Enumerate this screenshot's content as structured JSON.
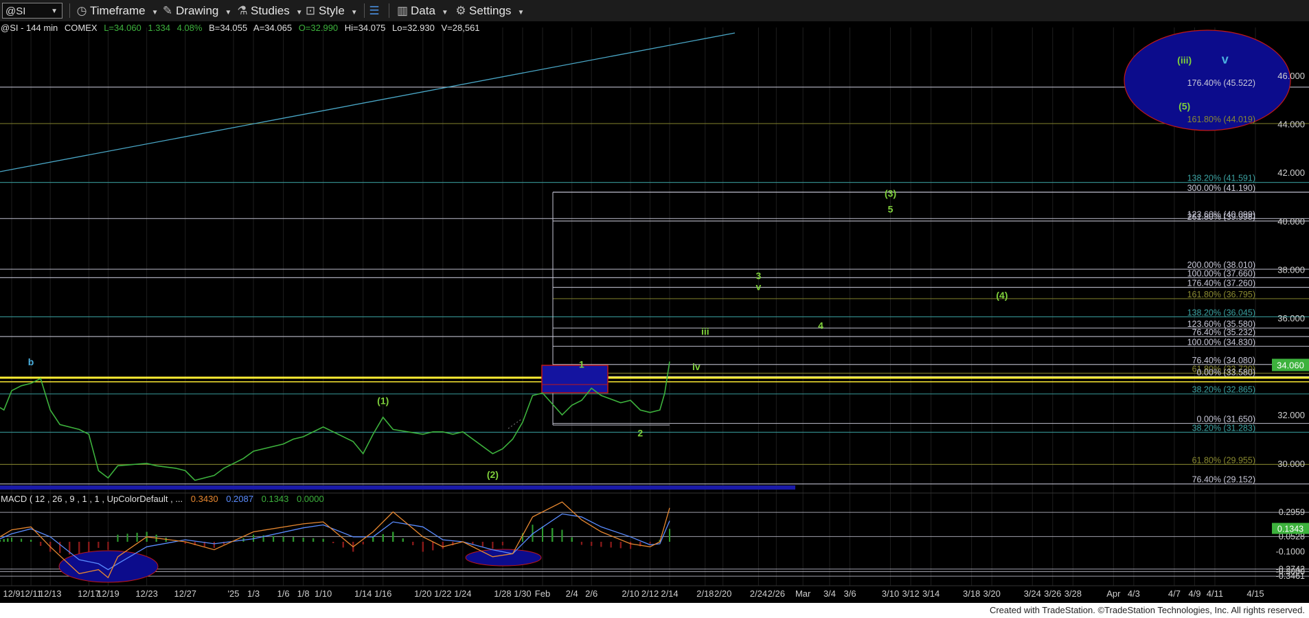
{
  "toolbar": {
    "symbol": "@SI",
    "timeframe": "Timeframe",
    "drawing": "Drawing",
    "studies": "Studies",
    "style": "Style",
    "data": "Data",
    "settings": "Settings"
  },
  "header": {
    "ticker": "@SI - 144 min",
    "exchange": "COMEX",
    "last": "L=34.060",
    "change": "1.334",
    "change_pct": "4.08%",
    "bid": "B=34.055",
    "ask": "A=34.065",
    "open": "O=32.990",
    "high": "Hi=34.075",
    "low": "Lo=32.930",
    "volume": "V=28,561"
  },
  "macd_header": {
    "label": "MACD ( 12 , 26 , 9 , 1 , 1 , UpColorDefault , ...",
    "v1": "0.3430",
    "v2": "0.2087",
    "v3": "0.1343",
    "v4": "0.0000"
  },
  "footer": "Created with TradeStation. ©TradeStation Technologies, Inc. All rights reserved.",
  "colors": {
    "price": "#3db23d",
    "yellow": "#ffee33",
    "fib_white": "#c8c8d8",
    "fib_teal": "#3aa0a0",
    "fib_olive": "#8a8a30",
    "trend": "#4aa8c8",
    "box_blue": "#1414a0",
    "box_red": "#c01818",
    "macd_hist_pos": "#2e9a2e",
    "macd_hist_neg": "#8a1a1a",
    "macd_orange": "#e88830",
    "macd_blue": "#5a8cff",
    "last_price_bg": "#3db23d"
  },
  "chart_data": {
    "type": "line",
    "symbol": "@SI",
    "interval": "144 min",
    "price_axis": {
      "ylim": [
        28.6,
        47.6
      ],
      "ticks": [
        "46.000",
        "44.000",
        "42.000",
        "40.000",
        "38.000",
        "36.000",
        "34.000",
        "32.000",
        "30.000"
      ],
      "tick_values": [
        46,
        44,
        42,
        40,
        38,
        36,
        34,
        32,
        30
      ]
    },
    "last_price": {
      "value": 34.06,
      "label": "34.060"
    },
    "x_axis": {
      "date_range": [
        "2024-12-06",
        "2025-04-17"
      ],
      "ticks": [
        {
          "date": "2024-12-09",
          "label": "12/9"
        },
        {
          "date": "2024-12-11",
          "label": "12/11"
        },
        {
          "date": "2024-12-13",
          "label": "12/13"
        },
        {
          "date": "2024-12-17",
          "label": "12/17"
        },
        {
          "date": "2024-12-19",
          "label": "12/19"
        },
        {
          "date": "2024-12-23",
          "label": "12/23"
        },
        {
          "date": "2024-12-27",
          "label": "12/27"
        },
        {
          "date": "2025-01-01",
          "label": "'25"
        },
        {
          "date": "2025-01-03",
          "label": "1/3"
        },
        {
          "date": "2025-01-06",
          "label": "1/6"
        },
        {
          "date": "2025-01-08",
          "label": "1/8"
        },
        {
          "date": "2025-01-10",
          "label": "1/10"
        },
        {
          "date": "2025-01-14",
          "label": "1/14"
        },
        {
          "date": "2025-01-16",
          "label": "1/16"
        },
        {
          "date": "2025-01-20",
          "label": "1/20"
        },
        {
          "date": "2025-01-22",
          "label": "1/22"
        },
        {
          "date": "2025-01-24",
          "label": "1/24"
        },
        {
          "date": "2025-01-28",
          "label": "1/28"
        },
        {
          "date": "2025-01-30",
          "label": "1/30"
        },
        {
          "date": "2025-02-01",
          "label": "Feb"
        },
        {
          "date": "2025-02-04",
          "label": "2/4"
        },
        {
          "date": "2025-02-06",
          "label": "2/6"
        },
        {
          "date": "2025-02-10",
          "label": "2/10"
        },
        {
          "date": "2025-02-12",
          "label": "2/12"
        },
        {
          "date": "2025-02-14",
          "label": "2/14"
        },
        {
          "date": "2025-02-18",
          "label": "2/18"
        },
        {
          "date": "2025-02-20",
          "label": "2/20"
        },
        {
          "date": "2025-02-24",
          "label": "2/24"
        },
        {
          "date": "2025-02-26",
          "label": "2/26"
        },
        {
          "date": "2025-03-01",
          "label": "Mar"
        },
        {
          "date": "2025-03-04",
          "label": "3/4"
        },
        {
          "date": "2025-03-06",
          "label": "3/6"
        },
        {
          "date": "2025-03-10",
          "label": "3/10"
        },
        {
          "date": "2025-03-12",
          "label": "3/12"
        },
        {
          "date": "2025-03-14",
          "label": "3/14"
        },
        {
          "date": "2025-03-18",
          "label": "3/18"
        },
        {
          "date": "2025-03-20",
          "label": "3/20"
        },
        {
          "date": "2025-03-24",
          "label": "3/24"
        },
        {
          "date": "2025-03-26",
          "label": "3/26"
        },
        {
          "date": "2025-03-28",
          "label": "3/28"
        },
        {
          "date": "2025-04-01",
          "label": "Apr"
        },
        {
          "date": "2025-04-03",
          "label": "4/3"
        },
        {
          "date": "2025-04-07",
          "label": "4/7"
        },
        {
          "date": "2025-04-09",
          "label": "4/9"
        },
        {
          "date": "2025-04-11",
          "label": "4/11"
        },
        {
          "date": "2025-04-15",
          "label": "4/15"
        }
      ]
    },
    "price_series": [
      [
        "2024-12-06",
        32.3
      ],
      [
        "2024-12-07",
        32.2
      ],
      [
        "2024-12-09",
        33.0
      ],
      [
        "2024-12-10",
        33.2
      ],
      [
        "2024-12-11",
        33.3
      ],
      [
        "2024-12-12",
        33.5
      ],
      [
        "2024-12-13",
        32.2
      ],
      [
        "2024-12-14",
        31.6
      ],
      [
        "2024-12-16",
        31.4
      ],
      [
        "2024-12-17",
        31.2
      ],
      [
        "2024-12-18",
        29.7
      ],
      [
        "2024-12-19",
        29.4
      ],
      [
        "2024-12-20",
        29.9
      ],
      [
        "2024-12-23",
        30.0
      ],
      [
        "2024-12-24",
        29.9
      ],
      [
        "2024-12-26",
        29.8
      ],
      [
        "2024-12-27",
        29.7
      ],
      [
        "2024-12-28",
        29.3
      ],
      [
        "2024-12-30",
        29.5
      ],
      [
        "2024-12-31",
        29.8
      ],
      [
        "2025-01-02",
        30.2
      ],
      [
        "2025-01-03",
        30.5
      ],
      [
        "2025-01-06",
        30.8
      ],
      [
        "2025-01-07",
        31.0
      ],
      [
        "2025-01-08",
        31.1
      ],
      [
        "2025-01-09",
        31.3
      ],
      [
        "2025-01-10",
        31.5
      ],
      [
        "2025-01-13",
        30.9
      ],
      [
        "2025-01-14",
        30.4
      ],
      [
        "2025-01-15",
        31.2
      ],
      [
        "2025-01-16",
        31.9
      ],
      [
        "2025-01-17",
        31.4
      ],
      [
        "2025-01-20",
        31.2
      ],
      [
        "2025-01-21",
        31.3
      ],
      [
        "2025-01-22",
        31.3
      ],
      [
        "2025-01-23",
        31.2
      ],
      [
        "2025-01-24",
        31.3
      ],
      [
        "2025-01-27",
        30.4
      ],
      [
        "2025-01-28",
        30.6
      ],
      [
        "2025-01-29",
        31.0
      ],
      [
        "2025-01-30",
        31.7
      ],
      [
        "2025-01-31",
        32.8
      ],
      [
        "2025-02-01",
        32.9
      ],
      [
        "2025-02-03",
        32.0
      ],
      [
        "2025-02-04",
        32.4
      ],
      [
        "2025-02-05",
        32.6
      ],
      [
        "2025-02-06",
        33.1
      ],
      [
        "2025-02-07",
        32.8
      ],
      [
        "2025-02-09",
        32.5
      ],
      [
        "2025-02-10",
        32.6
      ],
      [
        "2025-02-11",
        32.2
      ],
      [
        "2025-02-12",
        32.1
      ],
      [
        "2025-02-13",
        32.2
      ],
      [
        "2025-02-13T12",
        32.9
      ],
      [
        "2025-02-14",
        34.2
      ]
    ],
    "horizontal_levels": [
      {
        "pct": "176.40%",
        "value": 45.522,
        "color": "fib_white"
      },
      {
        "pct": "161.80%",
        "value": 44.019,
        "color": "fib_olive"
      },
      {
        "pct": "138.20%",
        "value": 41.591,
        "color": "fib_teal"
      },
      {
        "pct": "300.00%",
        "value": 41.19,
        "color": "fib_white"
      },
      {
        "pct": "123.60%",
        "value": 40.099,
        "color": "fib_white"
      },
      {
        "pct": "261.80%",
        "value": 39.998,
        "color": "fib_white"
      },
      {
        "pct": "200.00%",
        "value": 38.01,
        "color": "fib_white"
      },
      {
        "pct": "100.00%",
        "value": 37.66,
        "color": "fib_white"
      },
      {
        "pct": "176.40%",
        "value": 37.26,
        "color": "fib_white"
      },
      {
        "pct": "161.80%",
        "value": 36.795,
        "color": "fib_olive"
      },
      {
        "pct": "138.20%",
        "value": 36.045,
        "color": "fib_teal"
      },
      {
        "pct": "123.60%",
        "value": 35.58,
        "color": "fib_white"
      },
      {
        "pct": "76.40%",
        "value": 35.232,
        "color": "fib_white"
      },
      {
        "pct": "100.00%",
        "value": 34.83,
        "color": "fib_white"
      },
      {
        "pct": "76.40%",
        "value": 34.08,
        "color": "fib_white"
      },
      {
        "pct": "61.80%",
        "value": 33.72,
        "color": "fib_olive"
      },
      {
        "pct": "0.00%",
        "value": 33.58,
        "color": "fib_white"
      },
      {
        "pct": "38.20%",
        "value": 32.865,
        "color": "fib_teal"
      },
      {
        "pct": "0.00%",
        "value": 31.65,
        "color": "fib_white"
      },
      {
        "pct": "38.20%",
        "value": 31.283,
        "color": "fib_teal"
      },
      {
        "pct": "61.80%",
        "value": 29.955,
        "color": "fib_olive"
      },
      {
        "pct": "76.40%",
        "value": 29.152,
        "color": "fib_white"
      }
    ],
    "wave_labels": [
      {
        "text": "(iii)",
        "date": "2025-04-08",
        "value": 46.5,
        "color": "#7fd13b"
      },
      {
        "text": "v",
        "date": "2025-04-12",
        "value": 46.5,
        "color": "#4ab0e0"
      },
      {
        "text": "(5)",
        "date": "2025-04-08",
        "value": 44.6,
        "color": "#7fd13b"
      },
      {
        "text": "(3)",
        "date": "2025-03-10",
        "value": 41.0,
        "color": "#7fd13b"
      },
      {
        "text": "5",
        "date": "2025-03-10",
        "value": 40.35,
        "color": "#7fd13b"
      },
      {
        "text": "3",
        "date": "2025-02-24",
        "value": 37.6,
        "color": "#7fd13b"
      },
      {
        "text": "v",
        "date": "2025-02-24",
        "value": 37.15,
        "color": "#7fd13b"
      },
      {
        "text": "(4)",
        "date": "2025-03-21",
        "value": 36.8,
        "color": "#7fd13b"
      },
      {
        "text": "4",
        "date": "2025-03-03",
        "value": 35.55,
        "color": "#7fd13b"
      },
      {
        "text": "iii",
        "date": "2025-02-18",
        "value": 35.3,
        "color": "#7fd13b"
      },
      {
        "text": "iv",
        "date": "2025-02-17",
        "value": 33.85,
        "color": "#7fd13b"
      },
      {
        "text": "1",
        "date": "2025-02-05",
        "value": 33.95,
        "color": "#7fd13b"
      },
      {
        "text": "2",
        "date": "2025-02-11",
        "value": 31.12,
        "color": "#7fd13b"
      },
      {
        "text": "(1)",
        "date": "2025-01-16",
        "value": 32.45,
        "color": "#7fd13b"
      },
      {
        "text": "(2)",
        "date": "2025-01-27",
        "value": 29.4,
        "color": "#7fd13b"
      },
      {
        "text": "b",
        "date": "2024-12-11",
        "value": 34.05,
        "color": "#4ab0e0"
      }
    ],
    "macd": {
      "axis_ticks": [
        "0.2959",
        "0.0528",
        "-0.1000",
        "-0.2742",
        "-0.3461",
        "-0.3000"
      ],
      "tick_values": [
        0.2959,
        0.0528,
        -0.1,
        -0.2742,
        -0.3461,
        -0.3
      ],
      "ylim": [
        -0.42,
        0.44
      ],
      "last_value_label": "0.1343",
      "macd_line": [
        [
          "2024-12-06",
          0.05
        ],
        [
          "2024-12-09",
          0.12
        ],
        [
          "2024-12-11",
          0.15
        ],
        [
          "2024-12-13",
          -0.05
        ],
        [
          "2024-12-16",
          -0.32
        ],
        [
          "2024-12-18",
          -0.28
        ],
        [
          "2024-12-19",
          -0.36
        ],
        [
          "2024-12-20",
          -0.15
        ],
        [
          "2024-12-23",
          0.05
        ],
        [
          "2024-12-27",
          0.0
        ],
        [
          "2024-12-30",
          -0.08
        ],
        [
          "2025-01-03",
          0.1
        ],
        [
          "2025-01-08",
          0.18
        ],
        [
          "2025-01-10",
          0.2
        ],
        [
          "2025-01-13",
          -0.05
        ],
        [
          "2025-01-15",
          0.1
        ],
        [
          "2025-01-17",
          0.3
        ],
        [
          "2025-01-20",
          0.05
        ],
        [
          "2025-01-22",
          -0.05
        ],
        [
          "2025-01-24",
          0.0
        ],
        [
          "2025-01-27",
          -0.15
        ],
        [
          "2025-01-29",
          -0.12
        ],
        [
          "2025-01-31",
          0.25
        ],
        [
          "2025-02-03",
          0.4
        ],
        [
          "2025-02-05",
          0.22
        ],
        [
          "2025-02-07",
          0.1
        ],
        [
          "2025-02-10",
          -0.02
        ],
        [
          "2025-02-12",
          -0.05
        ],
        [
          "2025-02-13",
          0.0
        ],
        [
          "2025-02-14",
          0.34
        ]
      ],
      "signal_line": [
        [
          "2024-12-06",
          0.03
        ],
        [
          "2024-12-09",
          0.08
        ],
        [
          "2024-12-11",
          0.13
        ],
        [
          "2024-12-13",
          0.05
        ],
        [
          "2024-12-16",
          -0.18
        ],
        [
          "2024-12-18",
          -0.22
        ],
        [
          "2024-12-19",
          -0.28
        ],
        [
          "2024-12-20",
          -0.22
        ],
        [
          "2024-12-23",
          -0.05
        ],
        [
          "2024-12-27",
          0.02
        ],
        [
          "2024-12-30",
          -0.02
        ],
        [
          "2025-01-03",
          0.03
        ],
        [
          "2025-01-08",
          0.14
        ],
        [
          "2025-01-10",
          0.17
        ],
        [
          "2025-01-13",
          0.05
        ],
        [
          "2025-01-15",
          0.05
        ],
        [
          "2025-01-17",
          0.2
        ],
        [
          "2025-01-20",
          0.15
        ],
        [
          "2025-01-22",
          0.02
        ],
        [
          "2025-01-24",
          0.0
        ],
        [
          "2025-01-27",
          -0.08
        ],
        [
          "2025-01-29",
          -0.12
        ],
        [
          "2025-01-31",
          0.08
        ],
        [
          "2025-02-03",
          0.28
        ],
        [
          "2025-02-05",
          0.25
        ],
        [
          "2025-02-07",
          0.15
        ],
        [
          "2025-02-10",
          0.05
        ],
        [
          "2025-02-12",
          -0.03
        ],
        [
          "2025-02-13",
          -0.02
        ],
        [
          "2025-02-14",
          0.21
        ]
      ]
    }
  }
}
